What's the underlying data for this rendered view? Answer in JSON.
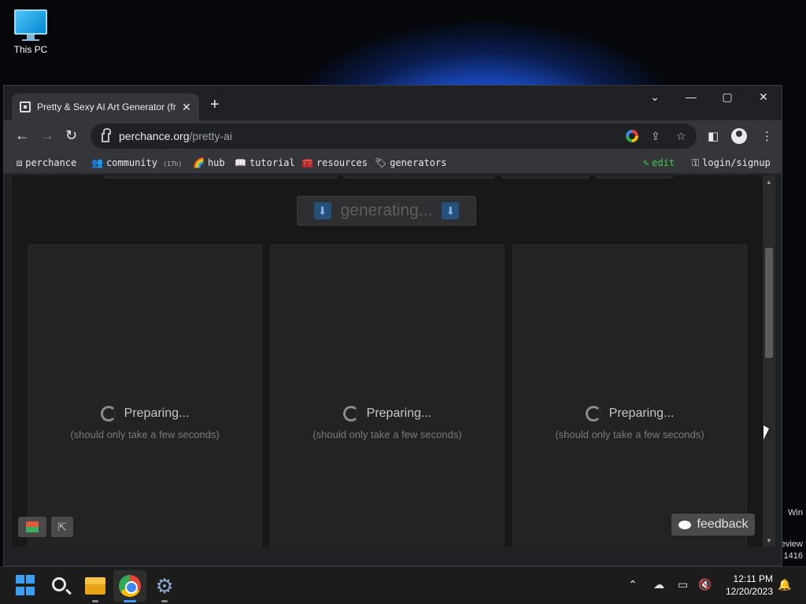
{
  "desktop": {
    "icon_label": "This PC",
    "side_text": [
      "Win",
      "eview",
      "1416"
    ]
  },
  "browser": {
    "tab_title": "Pretty & Sexy AI Art Generator (fr",
    "tab_close": "✕",
    "new_tab": "+",
    "url_host": "perchance.org",
    "url_path": "/pretty-ai",
    "bookmarks": {
      "perchance": "perchance",
      "community": "community",
      "community_count": "(17h)",
      "hub": "hub",
      "tutorial": "tutorial",
      "resources": "resources",
      "generators": "generators",
      "edit": "edit",
      "login": "login/signup"
    }
  },
  "page": {
    "generate_label": "generating...",
    "cards": [
      {
        "status": "Preparing...",
        "note": "(should only take a few seconds)"
      },
      {
        "status": "Preparing...",
        "note": "(should only take a few seconds)"
      },
      {
        "status": "Preparing...",
        "note": "(should only take a few seconds)"
      }
    ],
    "feedback_label": "feedback"
  },
  "taskbar": {
    "time": "12:11 PM",
    "date": "12/20/2023"
  },
  "colors": {
    "accent_edit": "#3fce4a",
    "windows_blue": "#3aa0f3"
  }
}
